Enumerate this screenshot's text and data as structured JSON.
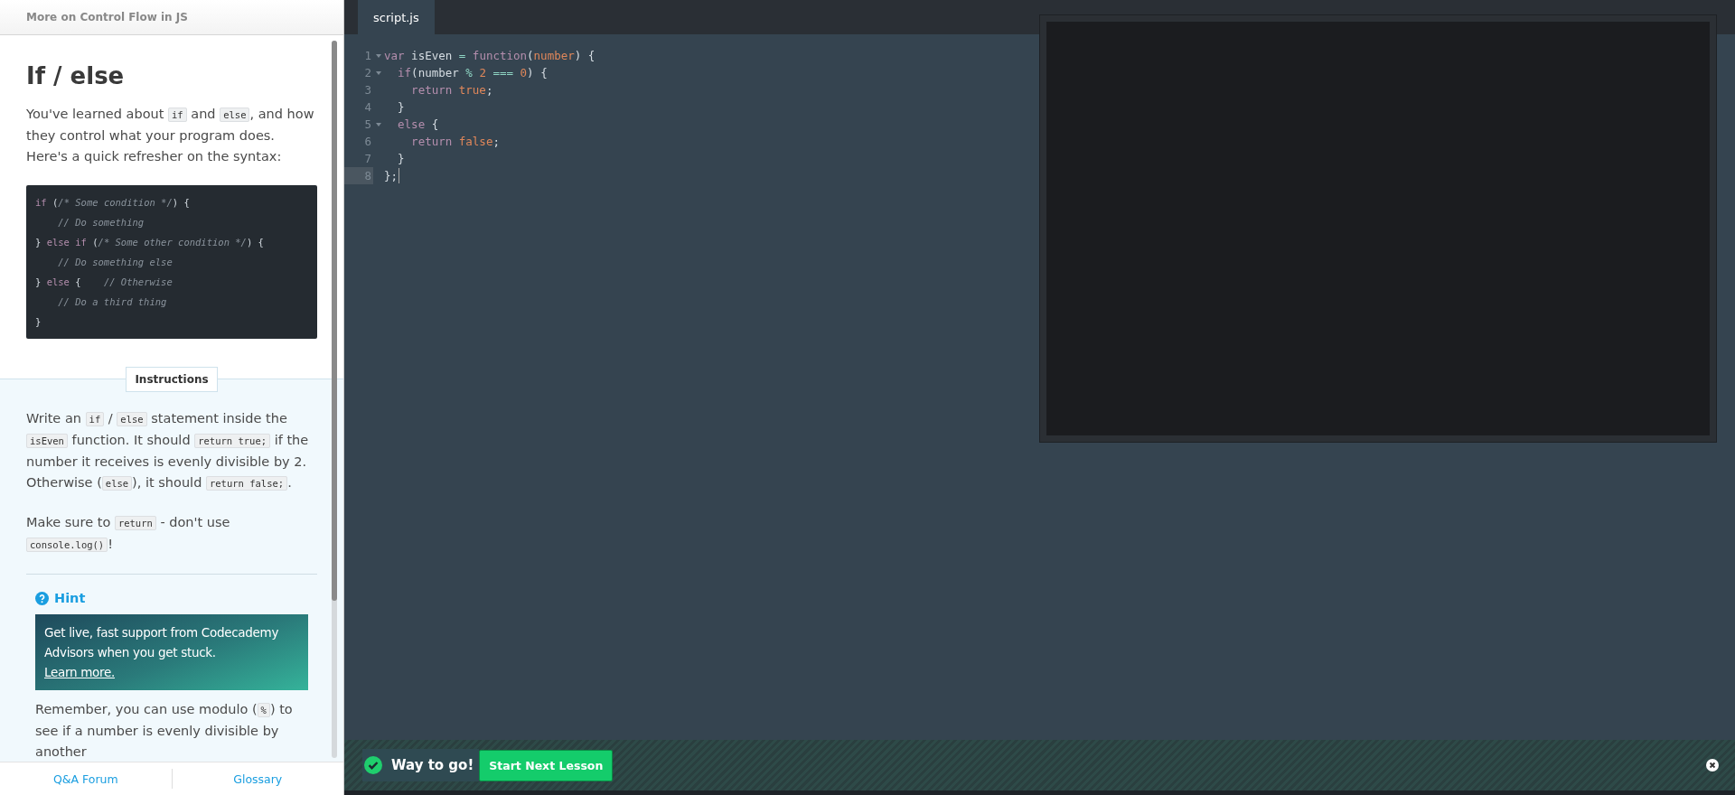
{
  "lesson_header": {
    "title": "More on Control Flow in JS"
  },
  "lesson": {
    "heading": "If / else",
    "intro": [
      {
        "kind": "text",
        "text": "You've learned about "
      },
      {
        "kind": "code",
        "text": "if"
      },
      {
        "kind": "text",
        "text": " and "
      },
      {
        "kind": "code",
        "text": "else"
      },
      {
        "kind": "text",
        "text": ", and how they control what your program does. Here's a quick refresher on the syntax:"
      }
    ],
    "snippet": [
      [
        {
          "kind": "kw",
          "text": "if"
        },
        {
          "kind": "plain",
          "text": " ("
        },
        {
          "kind": "comment",
          "text": "/* Some condition */"
        },
        {
          "kind": "plain",
          "text": ") {"
        }
      ],
      [
        {
          "kind": "comment",
          "text": "    // Do something"
        }
      ],
      [
        {
          "kind": "plain",
          "text": "} "
        },
        {
          "kind": "kw",
          "text": "else if"
        },
        {
          "kind": "plain",
          "text": " ("
        },
        {
          "kind": "comment",
          "text": "/* Some other condition */"
        },
        {
          "kind": "plain",
          "text": ") {"
        }
      ],
      [
        {
          "kind": "comment",
          "text": "    // Do something else"
        }
      ],
      [
        {
          "kind": "plain",
          "text": "} "
        },
        {
          "kind": "kw",
          "text": "else"
        },
        {
          "kind": "plain",
          "text": " {    "
        },
        {
          "kind": "comment",
          "text": "// Otherwise"
        }
      ],
      [
        {
          "kind": "comment",
          "text": "    // Do a third thing"
        }
      ],
      [
        {
          "kind": "plain",
          "text": "}"
        }
      ]
    ]
  },
  "instructions": {
    "tab_label": "Instructions",
    "paragraphs": [
      [
        {
          "kind": "text",
          "text": "Write an "
        },
        {
          "kind": "code",
          "text": "if"
        },
        {
          "kind": "text",
          "text": " / "
        },
        {
          "kind": "code",
          "text": "else"
        },
        {
          "kind": "text",
          "text": " statement inside the "
        },
        {
          "kind": "code",
          "text": "isEven"
        },
        {
          "kind": "text",
          "text": " function. It should "
        },
        {
          "kind": "code",
          "text": "return true;"
        },
        {
          "kind": "text",
          "text": " if the number it receives is evenly divisible by 2. Otherwise ("
        },
        {
          "kind": "code",
          "text": "else"
        },
        {
          "kind": "text",
          "text": "), it should "
        },
        {
          "kind": "code",
          "text": "return false;"
        },
        {
          "kind": "text",
          "text": "."
        }
      ],
      [
        {
          "kind": "text",
          "text": "Make sure to "
        },
        {
          "kind": "code",
          "text": "return"
        },
        {
          "kind": "text",
          "text": " - don't use "
        },
        {
          "kind": "code",
          "text": "console.log()"
        },
        {
          "kind": "text",
          "text": "!"
        }
      ]
    ],
    "hint": {
      "label": "Hint",
      "promo_text": "Get live, fast support from Codecademy Advisors when you get stuck.",
      "promo_link": "Learn more.",
      "text": [
        {
          "kind": "text",
          "text": "Remember, you can use modulo ("
        },
        {
          "kind": "code",
          "text": "%"
        },
        {
          "kind": "text",
          "text": ") to see if a number is evenly divisible by another"
        }
      ]
    }
  },
  "lesson_footer": {
    "links": [
      "Q&A Forum",
      "Glossary"
    ]
  },
  "editor": {
    "tabs": [
      {
        "label": "script.js",
        "selected": true
      }
    ],
    "lines": [
      {
        "number": "1",
        "fold": true,
        "active": false,
        "tokens": [
          {
            "kind": "kw",
            "text": "var"
          },
          {
            "kind": "plain",
            "text": " isEven "
          },
          {
            "kind": "op",
            "text": "="
          },
          {
            "kind": "kw",
            "text": " function"
          },
          {
            "kind": "plain",
            "text": "("
          },
          {
            "kind": "param",
            "text": "number"
          },
          {
            "kind": "plain",
            "text": ") {"
          }
        ]
      },
      {
        "number": "2",
        "fold": true,
        "active": false,
        "tokens": [
          {
            "kind": "kw",
            "text": "  if"
          },
          {
            "kind": "plain",
            "text": "(number "
          },
          {
            "kind": "op",
            "text": "%"
          },
          {
            "kind": "num",
            "text": " 2"
          },
          {
            "kind": "op",
            "text": " ==="
          },
          {
            "kind": "num",
            "text": " 0"
          },
          {
            "kind": "plain",
            "text": ") {"
          }
        ]
      },
      {
        "number": "3",
        "fold": false,
        "active": false,
        "tokens": [
          {
            "kind": "kw",
            "text": "    return"
          },
          {
            "kind": "num",
            "text": " true"
          },
          {
            "kind": "plain",
            "text": ";"
          }
        ]
      },
      {
        "number": "4",
        "fold": false,
        "active": false,
        "tokens": [
          {
            "kind": "plain",
            "text": "  }"
          }
        ]
      },
      {
        "number": "5",
        "fold": true,
        "active": false,
        "tokens": [
          {
            "kind": "kw",
            "text": "  else"
          },
          {
            "kind": "plain",
            "text": " {"
          }
        ]
      },
      {
        "number": "6",
        "fold": false,
        "active": false,
        "tokens": [
          {
            "kind": "kw",
            "text": "    return"
          },
          {
            "kind": "num",
            "text": " false"
          },
          {
            "kind": "plain",
            "text": ";"
          }
        ]
      },
      {
        "number": "7",
        "fold": false,
        "active": false,
        "tokens": [
          {
            "kind": "plain",
            "text": "  }"
          }
        ]
      },
      {
        "number": "8",
        "fold": false,
        "active": true,
        "tokens": [
          {
            "kind": "plain",
            "text": "};"
          }
        ]
      }
    ]
  },
  "success_bar": {
    "message": "Way to go!",
    "button": "Start Next Lesson"
  }
}
